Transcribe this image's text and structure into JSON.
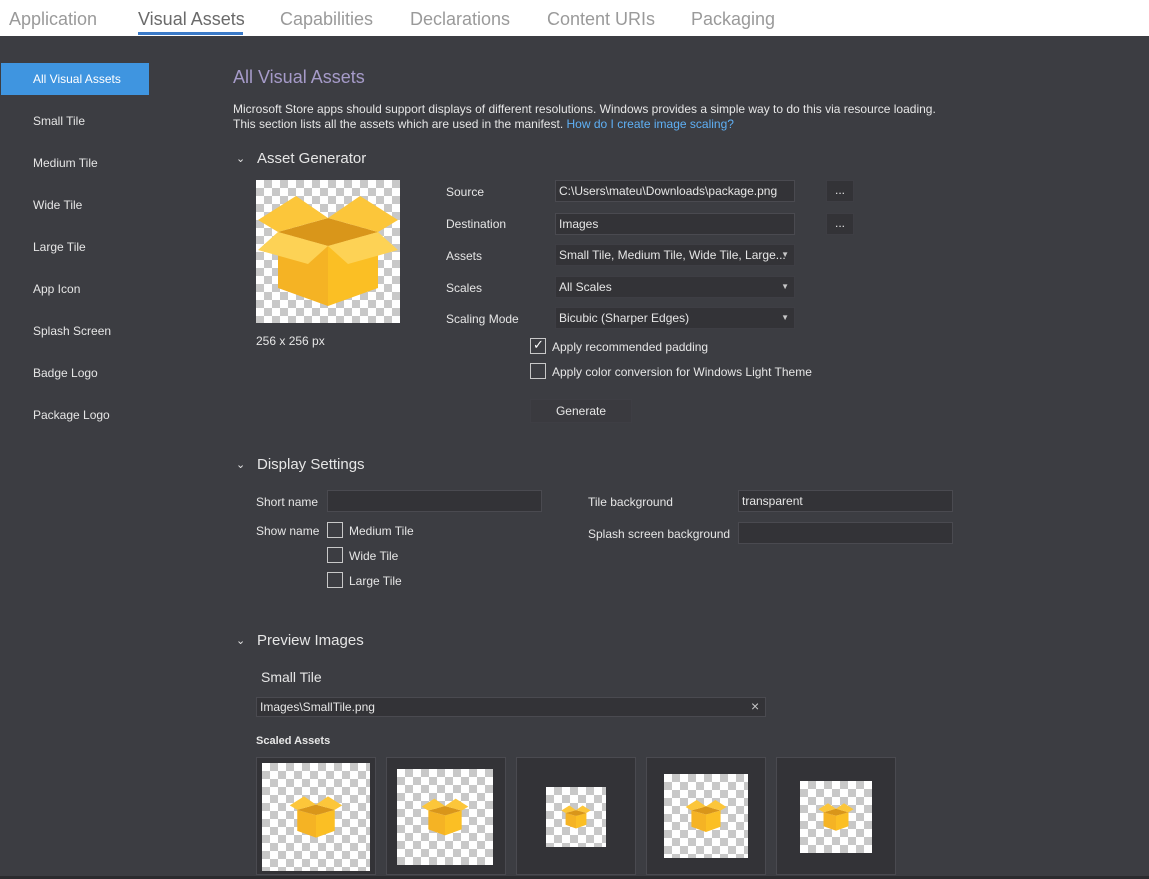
{
  "tabs": [
    {
      "label": "Application"
    },
    {
      "label": "Visual Assets"
    },
    {
      "label": "Capabilities"
    },
    {
      "label": "Declarations"
    },
    {
      "label": "Content URIs"
    },
    {
      "label": "Packaging"
    }
  ],
  "sidebar": {
    "items": [
      {
        "label": "All Visual Assets"
      },
      {
        "label": "Small Tile"
      },
      {
        "label": "Medium Tile"
      },
      {
        "label": "Wide Tile"
      },
      {
        "label": "Large Tile"
      },
      {
        "label": "App Icon"
      },
      {
        "label": "Splash Screen"
      },
      {
        "label": "Badge Logo"
      },
      {
        "label": "Package Logo"
      }
    ]
  },
  "main": {
    "title": "All Visual Assets",
    "description_line1": "Microsoft Store apps should support displays of different resolutions. Windows provides a simple way to do this via resource loading.",
    "description_line2": "This section lists all the assets which are used in the manifest.",
    "description_link": "How do I create image scaling?",
    "asset_generator": {
      "heading": "Asset Generator",
      "image_size": "256 x 256 px",
      "source_label": "Source",
      "source_value": "C:\\Users\\mateu\\Downloads\\package.png",
      "destination_label": "Destination",
      "destination_value": "Images",
      "browse_label": "...",
      "assets_label": "Assets",
      "assets_value": "Small Tile, Medium Tile, Wide Tile, Large...",
      "scales_label": "Scales",
      "scales_value": "All Scales",
      "scaling_mode_label": "Scaling Mode",
      "scaling_mode_value": "Bicubic (Sharper Edges)",
      "padding_label": "Apply recommended padding",
      "padding_checked": true,
      "color_conversion_label": "Apply color conversion for Windows Light Theme",
      "color_conversion_checked": false,
      "generate_label": "Generate"
    },
    "display_settings": {
      "heading": "Display Settings",
      "short_name_label": "Short name",
      "short_name_value": "",
      "show_name_label": "Show name",
      "show_name_options": [
        {
          "label": "Medium Tile",
          "checked": false
        },
        {
          "label": "Wide Tile",
          "checked": false
        },
        {
          "label": "Large Tile",
          "checked": false
        }
      ],
      "tile_background_label": "Tile background",
      "tile_background_value": "transparent",
      "splash_background_label": "Splash screen background",
      "splash_background_value": ""
    },
    "preview_images": {
      "heading": "Preview Images",
      "small_tile_heading": "Small Tile",
      "small_tile_path": "Images\\SmallTile.png",
      "clear_label": "×",
      "scaled_assets_label": "Scaled Assets"
    }
  },
  "colors": {
    "accent": "#3f95e0",
    "title": "#a69bc9",
    "link": "#5fb0f5",
    "background": "#3c3d42",
    "box_yellow": "#fbbf24"
  }
}
